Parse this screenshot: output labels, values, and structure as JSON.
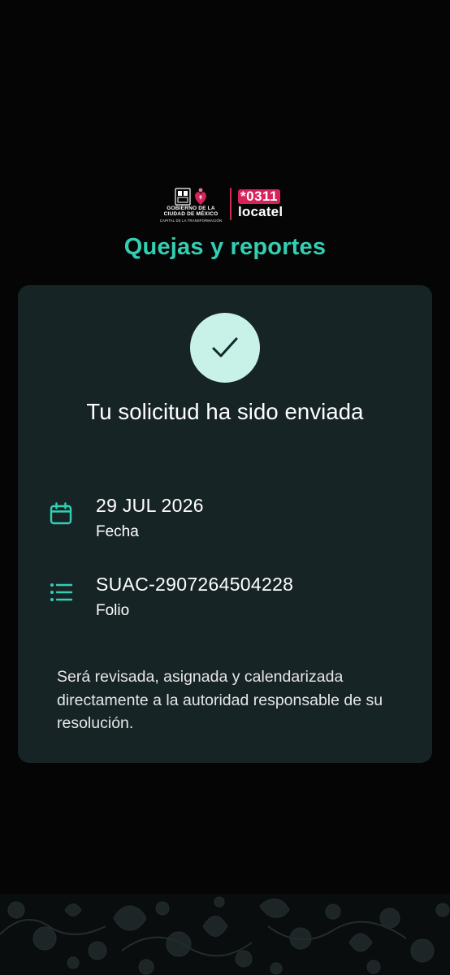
{
  "header": {
    "gov_logo_line1": "GOBIERNO DE LA",
    "gov_logo_line2": "CIUDAD DE MÉXICO",
    "gov_logo_sub": "CAPITAL DE LA TRANSFORMACIÓN",
    "locatel_number": "*0311",
    "locatel_word": "locatel",
    "title": "Quejas y reportes"
  },
  "card": {
    "heading": "Tu solicitud ha sido enviada",
    "date_value": "29 JUL 2026",
    "date_label": "Fecha",
    "folio_value": "SUAC-2907264504228",
    "folio_label": "Folio",
    "note": "Será revisada, asignada y calendarizada directamente a la autoridad responsable de su resolución."
  },
  "icons": {
    "success": "check-icon",
    "date": "calendar-icon",
    "folio": "list-icon"
  },
  "colors": {
    "background": "#050505",
    "card": "#172426",
    "accent": "#33cfb3",
    "check_circle": "#c8f2e8",
    "brand_pink": "#d6245b"
  }
}
